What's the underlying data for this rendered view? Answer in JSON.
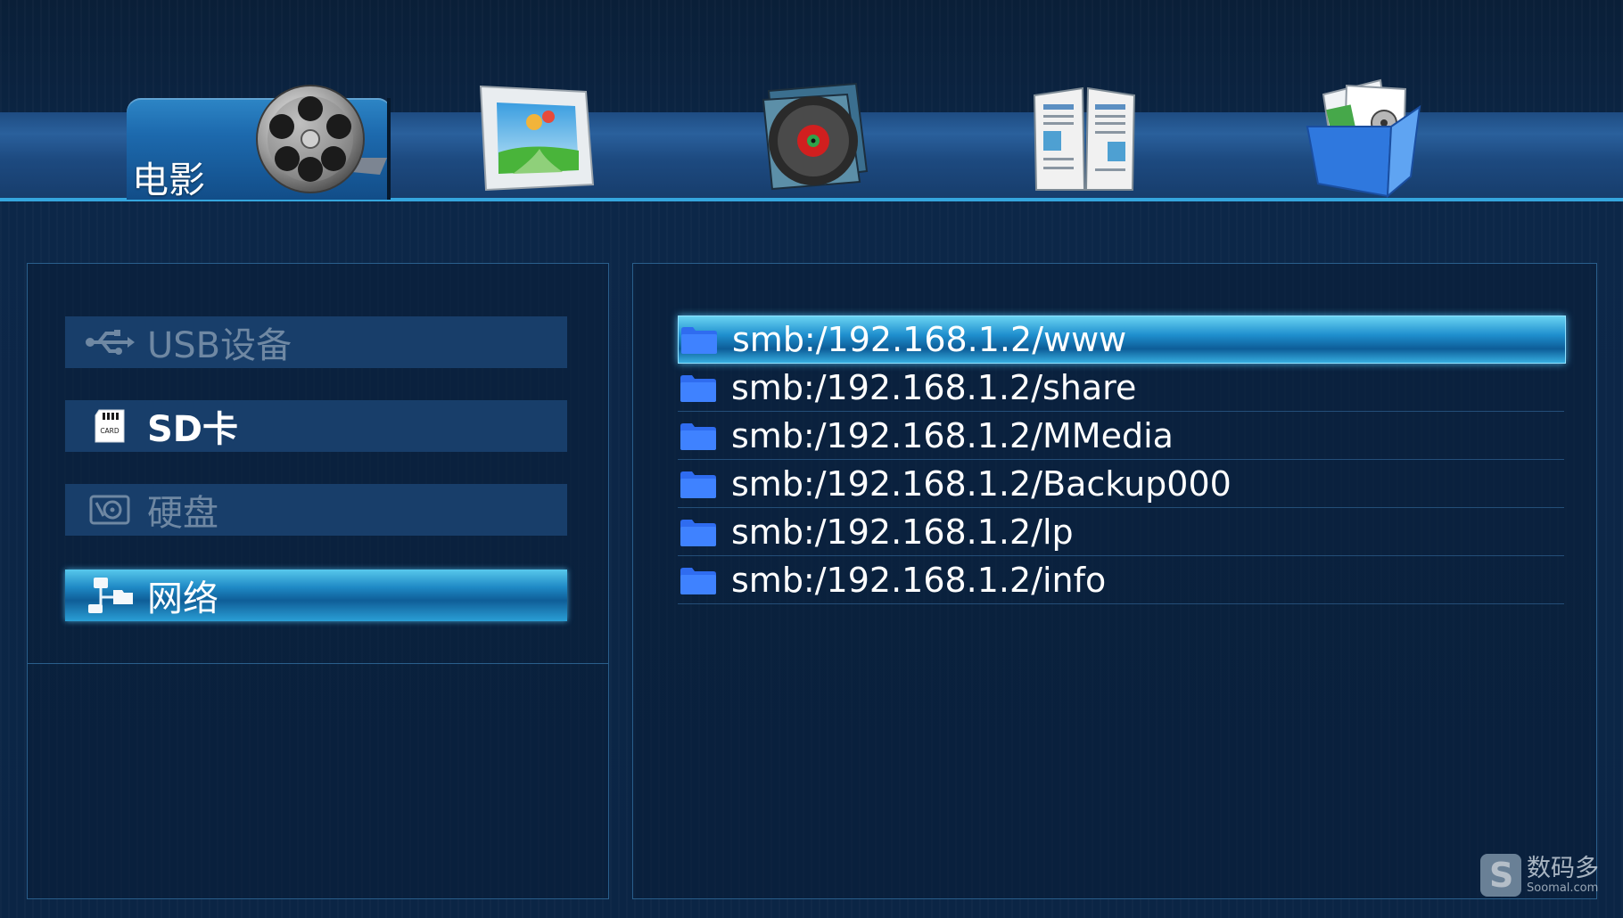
{
  "top_menu": {
    "active_tab_label": "电影",
    "tabs": [
      {
        "name": "movie",
        "icon": "film-reel-icon",
        "selected": true
      },
      {
        "name": "photo",
        "icon": "photo-frame-icon",
        "selected": false
      },
      {
        "name": "music",
        "icon": "music-disc-icon",
        "selected": false
      },
      {
        "name": "ebook",
        "icon": "book-icon",
        "selected": false
      },
      {
        "name": "file",
        "icon": "file-folder-icon",
        "selected": false
      }
    ]
  },
  "sources": [
    {
      "label": "USB设备",
      "icon": "usb-icon",
      "state": "disabled"
    },
    {
      "label": "SD卡",
      "icon": "sd-card-icon",
      "state": "enabled"
    },
    {
      "label": "硬盘",
      "icon": "hard-disk-icon",
      "state": "disabled"
    },
    {
      "label": "网络",
      "icon": "network-icon",
      "state": "selected"
    }
  ],
  "sd_card_icon_text": "CARD",
  "files": [
    {
      "name": "smb:/192.168.1.2/www",
      "icon": "folder-icon",
      "selected": true
    },
    {
      "name": "smb:/192.168.1.2/share",
      "icon": "folder-icon",
      "selected": false
    },
    {
      "name": "smb:/192.168.1.2/MMedia",
      "icon": "folder-icon",
      "selected": false
    },
    {
      "name": "smb:/192.168.1.2/Backup000",
      "icon": "folder-icon",
      "selected": false
    },
    {
      "name": "smb:/192.168.1.2/lp",
      "icon": "folder-icon",
      "selected": false
    },
    {
      "name": "smb:/192.168.1.2/info",
      "icon": "folder-icon",
      "selected": false
    }
  ],
  "watermark": {
    "cn": "数码多",
    "en": "Soomal.com"
  },
  "colors": {
    "background": "#0b2340",
    "accent": "#35a6de",
    "selection": "#1f8fce",
    "folder": "#2f6cf0"
  }
}
